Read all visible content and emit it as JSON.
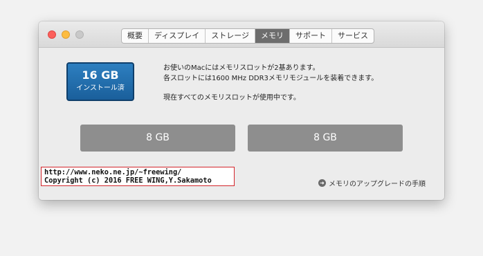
{
  "tabs": [
    {
      "label": "概要",
      "active": false
    },
    {
      "label": "ディスプレイ",
      "active": false
    },
    {
      "label": "ストレージ",
      "active": false
    },
    {
      "label": "メモリ",
      "active": true
    },
    {
      "label": "サポート",
      "active": false
    },
    {
      "label": "サービス",
      "active": false
    }
  ],
  "badge": {
    "size": "16 GB",
    "label": "インストール済"
  },
  "info": {
    "line1": "お使いのMacにはメモリスロットが2基あります。",
    "line2": "各スロットには1600 MHz DDR3メモリモジュールを装着できます。",
    "line3": "現在すべてのメモリスロットが使用中です。"
  },
  "slots": [
    {
      "label": "8 GB"
    },
    {
      "label": "8 GB"
    }
  ],
  "copyright": {
    "line1": "http://www.neko.ne.jp/~freewing/",
    "line2": "Copyright (c) 2016 FREE WING,Y.Sakamoto"
  },
  "upgrade": {
    "icon": "arrow-right-circle-icon",
    "label": "メモリのアップグレードの手順"
  },
  "colors": {
    "badge": "#1f6aa8",
    "slot": "#8e8e8e",
    "active_tab": "#6d6d6d",
    "copyright_border": "#d3242a"
  }
}
